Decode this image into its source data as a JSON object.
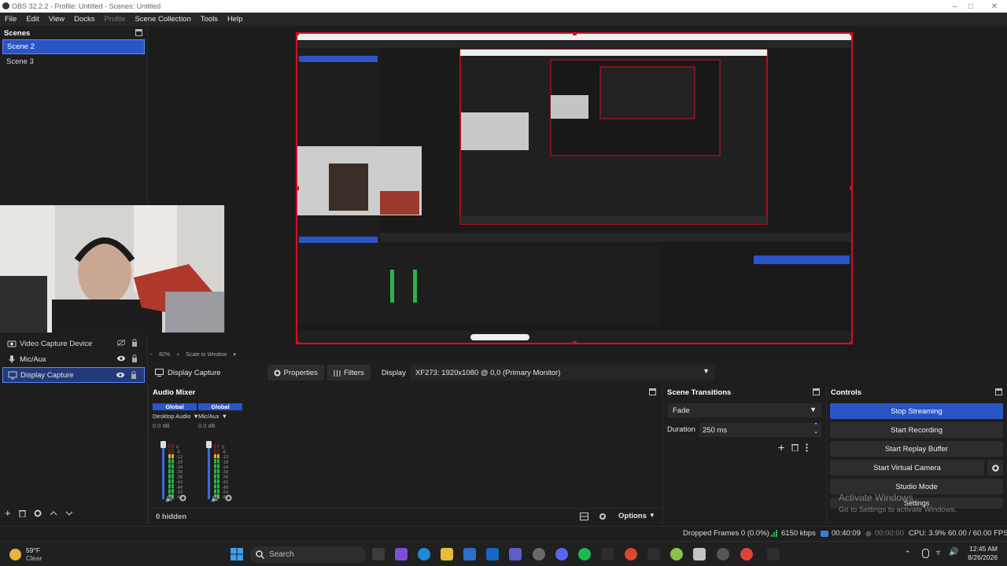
{
  "window": {
    "title": "OBS 32.2.2 - Profile: Untitled - Scenes: Untitled"
  },
  "menu": {
    "items": [
      "File",
      "Edit",
      "View",
      "Docks",
      "Profile",
      "Scene Collection",
      "Tools",
      "Help"
    ]
  },
  "scenes": {
    "title": "Scenes",
    "items": [
      "Scene 2",
      "Scene 3"
    ],
    "selected": "Scene 2"
  },
  "sources": {
    "items": [
      {
        "label": "Video Capture Device",
        "icon": "camera-icon"
      },
      {
        "label": "Mic/Aux",
        "icon": "microphone-icon"
      },
      {
        "label": "Display Capture",
        "icon": "monitor-icon"
      }
    ],
    "selected": "Display Capture"
  },
  "preview": {
    "zoom": "82%",
    "scale_mode": "Scale to Window"
  },
  "context_bar": {
    "source_name": "Display Capture",
    "properties_label": "Properties",
    "filters_label": "Filters",
    "display_label": "Display",
    "display_value": "XF273: 1920x1080 @ 0,0 (Primary Monitor)"
  },
  "audio_mixer": {
    "title": "Audio Mixer",
    "channels": [
      {
        "badge": "Global",
        "name": "Desktop Audio",
        "db": "0.0 dB"
      },
      {
        "badge": "Global",
        "name": "Mic/Aux",
        "db": "0.0 dB"
      }
    ],
    "meter_ticks": [
      "0",
      "-6",
      "-12",
      "-18",
      "-24",
      "-30",
      "-36",
      "-42",
      "-48",
      "-54",
      "-60"
    ],
    "hidden_count": "0 hidden",
    "options_label": "Options"
  },
  "scene_transitions": {
    "title": "Scene Transitions",
    "transition": "Fade",
    "duration_label": "Duration",
    "duration_value": "250 ms"
  },
  "controls": {
    "title": "Controls",
    "stop_streaming": "Stop Streaming",
    "start_recording": "Start Recording",
    "start_replay": "Start Replay Buffer",
    "start_virtual_camera": "Start Virtual Camera",
    "studio_mode": "Studio Mode",
    "settings": "Settings"
  },
  "watermark": {
    "line1": "Activate Windows",
    "line2": "Go to Settings to activate Windows."
  },
  "status": {
    "dropped_frames": "Dropped Frames 0 (0.0%)",
    "bitrate": "6150 kbps",
    "stream_time": "00:40:09",
    "record_time": "00:00:00",
    "cpu": "CPU: 3.9%",
    "fps": "60.00 / 60.00 FPS"
  },
  "taskbar": {
    "weather_temp": "59°F",
    "weather_desc": "Clear",
    "search_placeholder": "Search",
    "time": "12:45 AM",
    "date": "8/26/2026"
  },
  "colors": {
    "accent": "#2a55c7",
    "selection_border": "#d80d1c",
    "meter_green": "#2bb14a",
    "meter_yellow": "#c8b62a",
    "meter_red": "#c22a2a"
  }
}
